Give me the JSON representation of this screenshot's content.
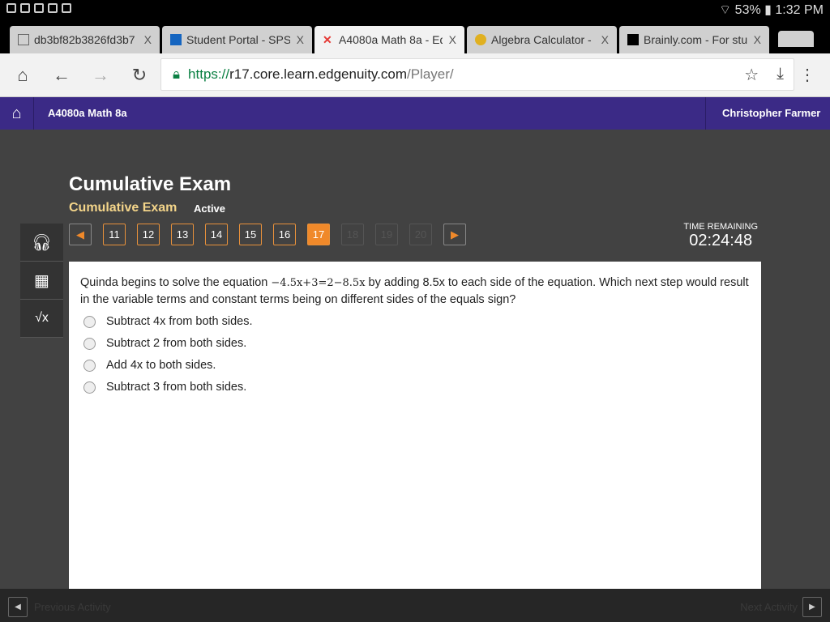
{
  "status": {
    "battery": "53%",
    "time": "1:32 PM"
  },
  "tabs": [
    {
      "label": "db3bf82b3826fd3b7"
    },
    {
      "label": "Student Portal - SPS"
    },
    {
      "label": "A4080a Math 8a - Ed"
    },
    {
      "label": "Algebra Calculator -"
    },
    {
      "label": "Brainly.com - For stu"
    }
  ],
  "url": {
    "scheme": "https://",
    "domain": "r17.core.learn.edgenuity.com",
    "path": "/Player/"
  },
  "header": {
    "course": "A4080a Math 8a",
    "user": "Christopher Farmer"
  },
  "title": "Cumulative Exam",
  "subtitle": "Cumulative Exam",
  "state": "Active",
  "questions": [
    "11",
    "12",
    "13",
    "14",
    "15",
    "16",
    "17",
    "18",
    "19",
    "20"
  ],
  "timer": {
    "label": "TIME REMAINING",
    "value": "02:24:48"
  },
  "question": {
    "pre": "Quinda begins to solve the equation ",
    "equation": "−4.5x+3=2−8.5x",
    "post": " by adding 8.5x to each side of the equation. Which next step would result in the variable terms and constant terms being on different sides of the equals sign?"
  },
  "options": [
    "Subtract 4x from both sides.",
    "Subtract 2 from both sides.",
    "Add 4x to both sides.",
    "Subtract 3 from both sides."
  ],
  "footer": {
    "prev": "Previous Activity",
    "next": "Next Activity"
  }
}
